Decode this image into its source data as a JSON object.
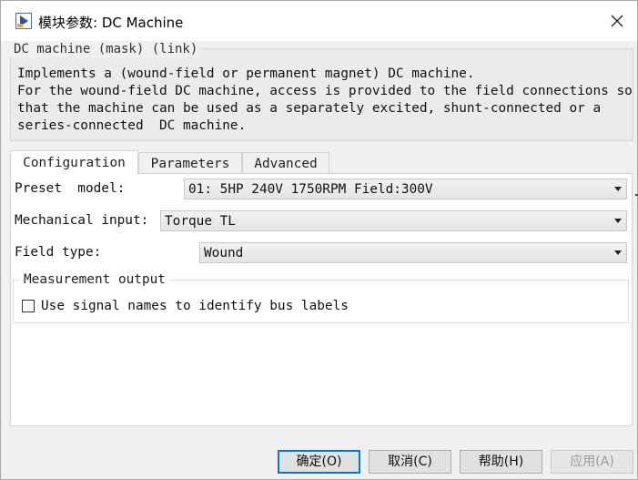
{
  "window": {
    "title": "模块参数: DC Machine",
    "icon": "simulink-block-icon",
    "close_icon": "close-icon"
  },
  "mask": {
    "legend": "DC machine (mask) (link)",
    "description": "Implements a (wound-field or permanent magnet) DC machine.\nFor the wound-field DC machine, access is provided to the field connections so\nthat the machine can be used as a separately excited, shunt-connected or a\nseries-connected  DC machine."
  },
  "tabs": [
    {
      "label": "Configuration",
      "active": true
    },
    {
      "label": "Parameters",
      "active": false
    },
    {
      "label": "Advanced",
      "active": false
    }
  ],
  "config": {
    "preset": {
      "label": "Preset  model:",
      "value": "01: 5HP 240V 1750RPM Field:300V"
    },
    "mechanical": {
      "label": "Mechanical input:",
      "value": "Torque TL"
    },
    "field_type": {
      "label": "Field type:",
      "value": "Wound"
    }
  },
  "measurement": {
    "legend": "Measurement output",
    "checkbox_label": "Use signal names to identify bus labels",
    "checked": false
  },
  "buttons": {
    "ok": "确定(O)",
    "cancel": "取消(C)",
    "help": "帮助(H)",
    "apply": "应用(A)"
  },
  "colors": {
    "focus_border": "#0078d7",
    "panel_bg": "#ffffff",
    "dialog_bg": "#f0f0f0"
  }
}
